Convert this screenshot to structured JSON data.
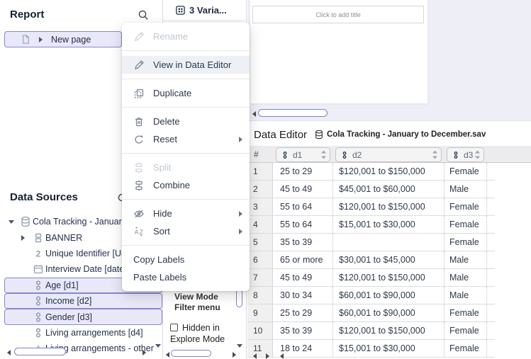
{
  "colors": {
    "accent_purple": "#8080d0",
    "selection_bg": "#e8e8f8",
    "selection_border": "#8787cd",
    "menu_highlight_bg": "#edf0f5",
    "canvas_bg": "#edeef6"
  },
  "sidebar": {
    "report": {
      "title": "Report",
      "search_icon": "search-icon",
      "new_page": {
        "label": "New page",
        "icon": "page-icon",
        "selected": true
      }
    },
    "data_sources": {
      "title": "Data Sources",
      "search_icon": "search-icon",
      "tree": [
        {
          "icon": "database-icon",
          "label": "Cola Tracking - January",
          "root": true,
          "caret_down": true
        },
        {
          "icon": "variable-set-icon",
          "label": "BANNER",
          "caret_right": true
        },
        {
          "icon": "numeric-icon",
          "label": "Unique Identifier [Un"
        },
        {
          "icon": "calendar-icon",
          "label": "Interview Date [date"
        },
        {
          "icon": "categorical-icon",
          "label": "Age [d1]",
          "selected": true
        },
        {
          "icon": "categorical-icon",
          "label": "Income [d2]",
          "selected": true
        },
        {
          "icon": "categorical-icon",
          "label": "Gender [d3]",
          "selected": true
        },
        {
          "icon": "categorical-icon",
          "label": "Living arrangements [d4]"
        },
        {
          "icon": "text-variable-icon",
          "label": "Living arrangements - other"
        }
      ]
    }
  },
  "middle_panel": {
    "tab": {
      "label": "3 Varia...",
      "icon": "table-grid-icon"
    },
    "properties": {
      "view_mode_label": "View Mode",
      "filter_menu_label": "Filter menu",
      "hidden_checkbox_label": "Hidden in Explore Mode",
      "checkbox_checked": false
    }
  },
  "canvas": {
    "title_placeholder": "Click to add title"
  },
  "context_menu": {
    "items": [
      {
        "label": "Rename",
        "icon": "pencil-icon",
        "disabled": true,
        "divider_after": true
      },
      {
        "label": "View in Data Editor",
        "icon": "pencil-icon",
        "highlighted": true,
        "divider_after": true
      },
      {
        "label": "Duplicate",
        "icon": "duplicate-icon",
        "divider_after": true
      },
      {
        "label": "Delete",
        "icon": "trash-icon"
      },
      {
        "label": "Reset",
        "icon": "reset-icon",
        "submenu": true,
        "divider_after": true
      },
      {
        "label": "Split",
        "icon": "split-icon",
        "disabled": true
      },
      {
        "label": "Combine",
        "icon": "combine-icon",
        "divider_after": true
      },
      {
        "label": "Hide",
        "icon": "eye-off-icon",
        "submenu": true
      },
      {
        "label": "Sort",
        "icon": "sort-az-icon",
        "submenu": true,
        "divider_after": true
      },
      {
        "label": "Copy Labels"
      },
      {
        "label": "Paste Labels"
      }
    ]
  },
  "data_editor": {
    "title": "Data Editor",
    "file_icon": "database-icon",
    "file_name": "Cola Tracking - January to December.sav",
    "columns": [
      {
        "id": "#"
      },
      {
        "id": "d1",
        "icon": "categorical-icon",
        "sortable": true
      },
      {
        "id": "d2",
        "icon": "categorical-icon",
        "sortable": true
      },
      {
        "id": "d3",
        "icon": "categorical-icon",
        "sortable": true
      }
    ],
    "rows": [
      {
        "n": "1",
        "d1": "25 to 29",
        "d2": "$120,001 to $150,000",
        "d3": "Female"
      },
      {
        "n": "2",
        "d1": "45 to 49",
        "d2": "$45,001 to $60,000",
        "d3": "Male"
      },
      {
        "n": "3",
        "d1": "55 to 64",
        "d2": "$120,001 to $150,000",
        "d3": "Female"
      },
      {
        "n": "4",
        "d1": "55 to 64",
        "d2": "$15,001 to $30,000",
        "d3": "Female"
      },
      {
        "n": "5",
        "d1": "35 to 39",
        "d2": "",
        "d3": "Female"
      },
      {
        "n": "6",
        "d1": "65 or more",
        "d2": "$30,001 to $45,000",
        "d3": "Male"
      },
      {
        "n": "7",
        "d1": "45 to 49",
        "d2": "$120,001 to $150,000",
        "d3": "Male"
      },
      {
        "n": "8",
        "d1": "30 to 34",
        "d2": "$60,001 to $90,000",
        "d3": "Male"
      },
      {
        "n": "9",
        "d1": "25 to 29",
        "d2": "$60,001 to $90,000",
        "d3": "Female"
      },
      {
        "n": "10",
        "d1": "35 to 39",
        "d2": "$120,001 to $150,000",
        "d3": "Female"
      },
      {
        "n": "11",
        "d1": "18 to 24",
        "d2": "$15,001 to $30,000",
        "d3": "Female"
      }
    ]
  }
}
